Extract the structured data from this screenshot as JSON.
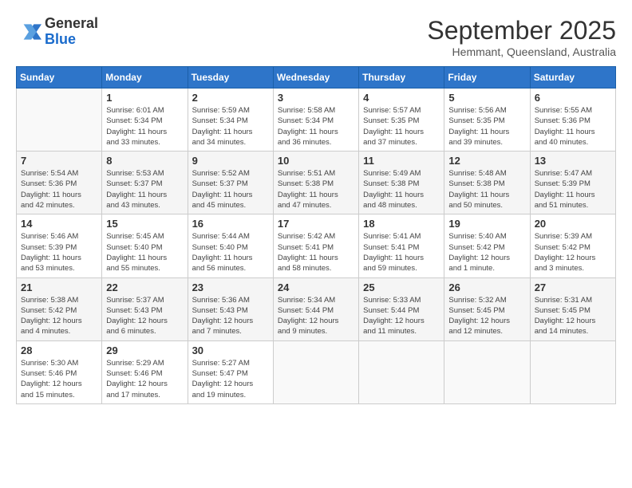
{
  "header": {
    "logo": {
      "general": "General",
      "blue": "Blue"
    },
    "title": "September 2025",
    "subtitle": "Hemmant, Queensland, Australia"
  },
  "days_of_week": [
    "Sunday",
    "Monday",
    "Tuesday",
    "Wednesday",
    "Thursday",
    "Friday",
    "Saturday"
  ],
  "weeks": [
    [
      {
        "day": "",
        "info": ""
      },
      {
        "day": "1",
        "info": "Sunrise: 6:01 AM\nSunset: 5:34 PM\nDaylight: 11 hours\nand 33 minutes."
      },
      {
        "day": "2",
        "info": "Sunrise: 5:59 AM\nSunset: 5:34 PM\nDaylight: 11 hours\nand 34 minutes."
      },
      {
        "day": "3",
        "info": "Sunrise: 5:58 AM\nSunset: 5:34 PM\nDaylight: 11 hours\nand 36 minutes."
      },
      {
        "day": "4",
        "info": "Sunrise: 5:57 AM\nSunset: 5:35 PM\nDaylight: 11 hours\nand 37 minutes."
      },
      {
        "day": "5",
        "info": "Sunrise: 5:56 AM\nSunset: 5:35 PM\nDaylight: 11 hours\nand 39 minutes."
      },
      {
        "day": "6",
        "info": "Sunrise: 5:55 AM\nSunset: 5:36 PM\nDaylight: 11 hours\nand 40 minutes."
      }
    ],
    [
      {
        "day": "7",
        "info": "Sunrise: 5:54 AM\nSunset: 5:36 PM\nDaylight: 11 hours\nand 42 minutes."
      },
      {
        "day": "8",
        "info": "Sunrise: 5:53 AM\nSunset: 5:37 PM\nDaylight: 11 hours\nand 43 minutes."
      },
      {
        "day": "9",
        "info": "Sunrise: 5:52 AM\nSunset: 5:37 PM\nDaylight: 11 hours\nand 45 minutes."
      },
      {
        "day": "10",
        "info": "Sunrise: 5:51 AM\nSunset: 5:38 PM\nDaylight: 11 hours\nand 47 minutes."
      },
      {
        "day": "11",
        "info": "Sunrise: 5:49 AM\nSunset: 5:38 PM\nDaylight: 11 hours\nand 48 minutes."
      },
      {
        "day": "12",
        "info": "Sunrise: 5:48 AM\nSunset: 5:38 PM\nDaylight: 11 hours\nand 50 minutes."
      },
      {
        "day": "13",
        "info": "Sunrise: 5:47 AM\nSunset: 5:39 PM\nDaylight: 11 hours\nand 51 minutes."
      }
    ],
    [
      {
        "day": "14",
        "info": "Sunrise: 5:46 AM\nSunset: 5:39 PM\nDaylight: 11 hours\nand 53 minutes."
      },
      {
        "day": "15",
        "info": "Sunrise: 5:45 AM\nSunset: 5:40 PM\nDaylight: 11 hours\nand 55 minutes."
      },
      {
        "day": "16",
        "info": "Sunrise: 5:44 AM\nSunset: 5:40 PM\nDaylight: 11 hours\nand 56 minutes."
      },
      {
        "day": "17",
        "info": "Sunrise: 5:42 AM\nSunset: 5:41 PM\nDaylight: 11 hours\nand 58 minutes."
      },
      {
        "day": "18",
        "info": "Sunrise: 5:41 AM\nSunset: 5:41 PM\nDaylight: 11 hours\nand 59 minutes."
      },
      {
        "day": "19",
        "info": "Sunrise: 5:40 AM\nSunset: 5:42 PM\nDaylight: 12 hours\nand 1 minute."
      },
      {
        "day": "20",
        "info": "Sunrise: 5:39 AM\nSunset: 5:42 PM\nDaylight: 12 hours\nand 3 minutes."
      }
    ],
    [
      {
        "day": "21",
        "info": "Sunrise: 5:38 AM\nSunset: 5:42 PM\nDaylight: 12 hours\nand 4 minutes."
      },
      {
        "day": "22",
        "info": "Sunrise: 5:37 AM\nSunset: 5:43 PM\nDaylight: 12 hours\nand 6 minutes."
      },
      {
        "day": "23",
        "info": "Sunrise: 5:36 AM\nSunset: 5:43 PM\nDaylight: 12 hours\nand 7 minutes."
      },
      {
        "day": "24",
        "info": "Sunrise: 5:34 AM\nSunset: 5:44 PM\nDaylight: 12 hours\nand 9 minutes."
      },
      {
        "day": "25",
        "info": "Sunrise: 5:33 AM\nSunset: 5:44 PM\nDaylight: 12 hours\nand 11 minutes."
      },
      {
        "day": "26",
        "info": "Sunrise: 5:32 AM\nSunset: 5:45 PM\nDaylight: 12 hours\nand 12 minutes."
      },
      {
        "day": "27",
        "info": "Sunrise: 5:31 AM\nSunset: 5:45 PM\nDaylight: 12 hours\nand 14 minutes."
      }
    ],
    [
      {
        "day": "28",
        "info": "Sunrise: 5:30 AM\nSunset: 5:46 PM\nDaylight: 12 hours\nand 15 minutes."
      },
      {
        "day": "29",
        "info": "Sunrise: 5:29 AM\nSunset: 5:46 PM\nDaylight: 12 hours\nand 17 minutes."
      },
      {
        "day": "30",
        "info": "Sunrise: 5:27 AM\nSunset: 5:47 PM\nDaylight: 12 hours\nand 19 minutes."
      },
      {
        "day": "",
        "info": ""
      },
      {
        "day": "",
        "info": ""
      },
      {
        "day": "",
        "info": ""
      },
      {
        "day": "",
        "info": ""
      }
    ]
  ]
}
